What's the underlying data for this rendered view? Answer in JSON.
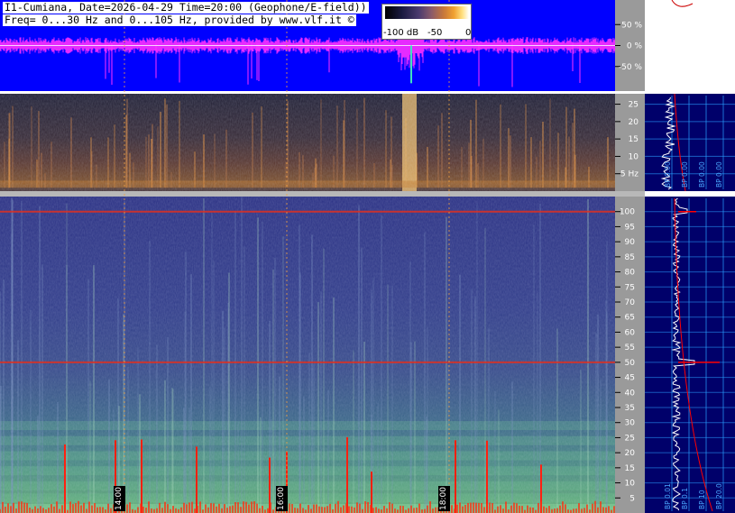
{
  "header": {
    "title": "I1-Cumiana, Date=2026-04-29 Time=20:00 (Geophone/E-field))",
    "freq": "Freq= 0...30 Hz and 0...105 Hz, provided by www.vlf.it ©"
  },
  "colorbar": {
    "labels": [
      "-100 dB",
      "-50",
      "0"
    ]
  },
  "colors": {
    "waveform_bg": "#0000ff",
    "waveform": "#ff30ff",
    "axis_bg": "#9a9a9a",
    "avg_panel_bg": "#00006a",
    "grid": "#2aa0ff",
    "trace": "#ffffff",
    "fit": "#ff0000"
  },
  "chart_data": [
    {
      "type": "area",
      "panel": "waveform",
      "ylim": [
        -100,
        100
      ],
      "y_ticks": [
        "50 %",
        "0 %",
        "-50 %"
      ]
    },
    {
      "type": "heatmap",
      "panel": "spectrogram-low",
      "ylim": [
        0,
        28
      ],
      "y_ticks": [
        "5 Hz",
        "10",
        "15",
        "20",
        "25"
      ],
      "side_axis_labels": [
        "BP 0.00",
        "BP 0.00",
        "BP 0.00",
        "BP 0.00"
      ]
    },
    {
      "type": "heatmap",
      "panel": "spectrogram-high",
      "ylim": [
        0,
        105
      ],
      "y_ticks": [
        "5",
        "10",
        "15",
        "20",
        "25",
        "30",
        "35",
        "40",
        "45",
        "50",
        "55",
        "60",
        "65",
        "70",
        "75",
        "80",
        "85",
        "90",
        "95",
        "100"
      ],
      "side_axis_labels": [
        "BP 0.01",
        "BP 0.1",
        "BP 10",
        "BP 20.0"
      ],
      "x_time_labels": [
        "14:00",
        "16:00",
        "18:00"
      ]
    }
  ]
}
